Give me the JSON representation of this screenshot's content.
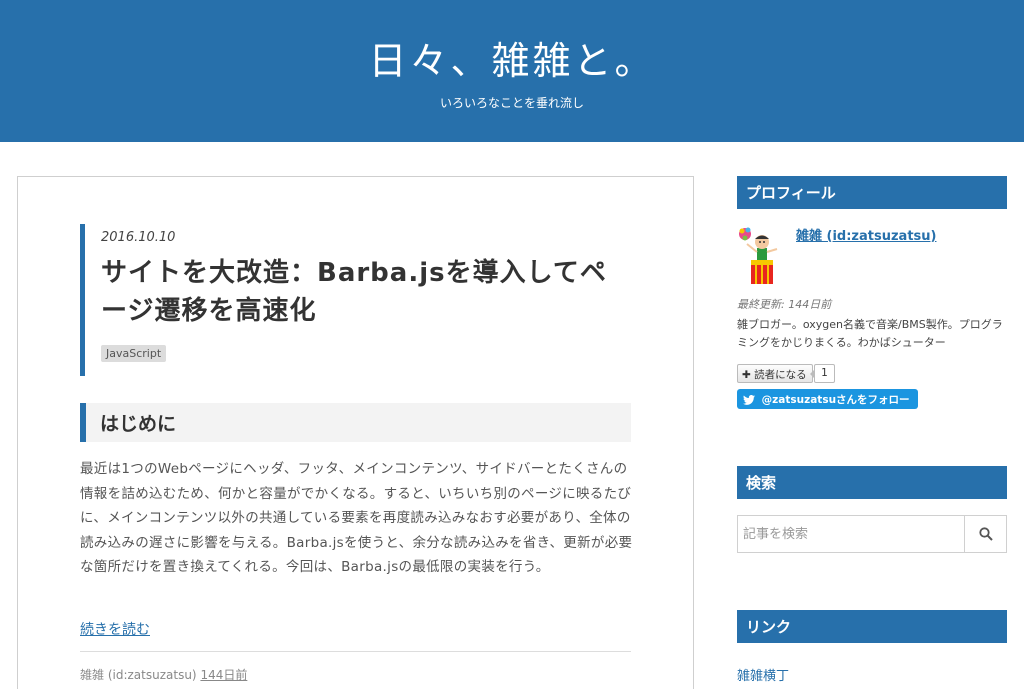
{
  "header": {
    "title": "日々、雑雑と。",
    "description": "いろいろなことを垂れ流し"
  },
  "entry": {
    "date": "2016.10.10",
    "title": "サイトを大改造：Barba.jsを導入してページ遷移を高速化",
    "category": "JavaScript",
    "section_heading": "はじめに",
    "body": "最近は1つのWebページにヘッダ、フッタ、メインコンテンツ、サイドバーとたくさんの情報を詰め込むため、何かと容量がでかくなる。すると、いちいち別のページに映るたびに、メインコンテンツ以外の共通している要素を再度読み込みなおす必要があり、全体の読み込みの遅さに影響を与える。Barba.jsを使うと、余分な読み込みを省き、更新が必要な箇所だけを置き換えてくれる。今回は、Barba.jsの最低限の実装を行う。",
    "read_more": "続きを読む",
    "author": "雑雑 (id:zatsuzatsu)",
    "ago": "144日前"
  },
  "sidebar": {
    "profile": {
      "heading": "プロフィール",
      "name": "雑雑 (id:zatsuzatsu)",
      "updated": "最終更新: 144日前",
      "description": "雑ブロガー。oxygen名義で音楽/BMS製作。プログラミングをかじりまくる。わかばシューター",
      "reader_button": "読者になる",
      "reader_count": "1",
      "follow_button": "@zatsuzatsuさんをフォロー"
    },
    "search": {
      "heading": "検索",
      "placeholder": "記事を検索"
    },
    "links": {
      "heading": "リンク",
      "items": [
        "雑雑横丁"
      ]
    }
  },
  "colors": {
    "brand": "#2770ab",
    "twitter": "#1b95e0"
  }
}
